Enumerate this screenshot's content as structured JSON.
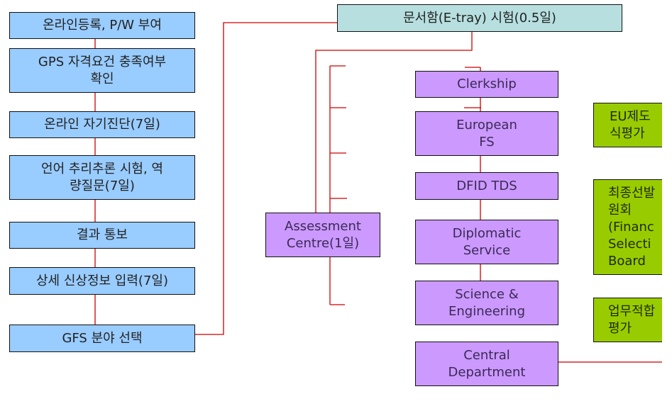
{
  "diagram": {
    "left_flow": [
      {
        "id": "online-registration",
        "label": "온라인등록, P/W 부여"
      },
      {
        "id": "gps-eligibility",
        "label": "GPS 자격요건 충족여부\n확인"
      },
      {
        "id": "online-self-diagnosis",
        "label": "온라인 자기진단(7일)"
      },
      {
        "id": "language-reasoning-test",
        "label": "언어 추리추론 시험, 역\n량질문(7일)"
      },
      {
        "id": "result-notice",
        "label": "결과 통보"
      },
      {
        "id": "personal-details",
        "label": "상세 신상정보 입력(7일)"
      },
      {
        "id": "gfs-field-selection",
        "label": "GFS 분야 선택"
      }
    ],
    "etray": {
      "label": "문서함(E-tray) 시험(0.5일)"
    },
    "assessment": {
      "label": "Assessment\nCentre(1일)"
    },
    "streams": [
      {
        "id": "clerkship",
        "label": "Clerkship"
      },
      {
        "id": "european-fs",
        "label": "European\nFS"
      },
      {
        "id": "dfid-tds",
        "label": "DFID TDS"
      },
      {
        "id": "diplomatic-service",
        "label": "Diplomatic\nService"
      },
      {
        "id": "science-engineering",
        "label": "Science &\nEngineering"
      },
      {
        "id": "central-department",
        "label": "Central\nDepartment"
      }
    ],
    "final_stages": [
      {
        "id": "eu-knowledge-eval",
        "label": "EU제도\n식평가"
      },
      {
        "id": "final-selection-board",
        "label": "최종선발\n원회\n(Financ\nSelecti\nBoard"
      },
      {
        "id": "job-suitability-eval",
        "label": "업무적합\n평가"
      }
    ],
    "colors": {
      "step_fill": "#99ccff",
      "etray_fill": "#b7dfe0",
      "stream_fill": "#cc99ff",
      "final_fill": "#99cc00",
      "connector": "#cc0000"
    }
  }
}
